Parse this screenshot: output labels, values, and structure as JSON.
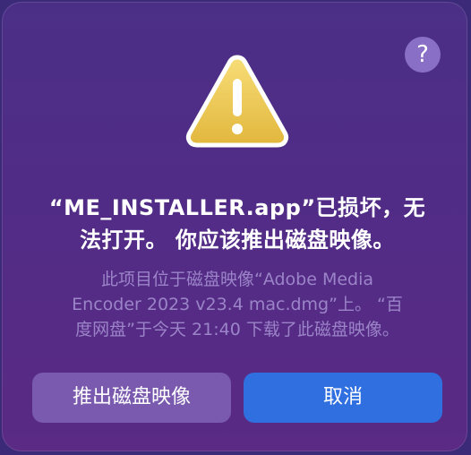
{
  "dialog": {
    "help_label": "?",
    "icon": "warning-triangle-icon",
    "title_line1": "“ME_INSTALLER.app”已损坏，无",
    "title_line2": "法打开。 你应该推出磁盘映像。",
    "message_line1": "此项目位于磁盘映像“Adobe Media",
    "message_line2": "Encoder 2023 v23.4 mac.dmg”上。 “百",
    "message_line3": "度网盘”于今天 21:40 下载了此磁盘映像。",
    "eject_button": "推出磁盘映像",
    "cancel_button": "取消"
  },
  "colors": {
    "dialog_background": "#512c86",
    "eject_button": "#7a5aae",
    "cancel_button": "#2f6fe0",
    "message_text": "#9b84c8",
    "warning_fill": "#f3cf5a"
  }
}
